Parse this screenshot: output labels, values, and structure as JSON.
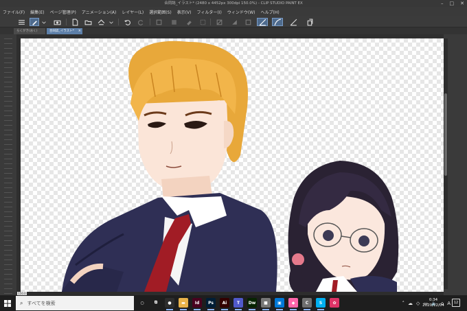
{
  "window": {
    "title": "合同誌_イラスト* (2480 x 4452px 300dpi 150.0%) - CLIP STUDIO PAINT EX",
    "min_icon": "minimize-icon",
    "max_icon": "maximize-icon",
    "close_icon": "close-icon"
  },
  "menu": {
    "items": [
      "ファイル(F)",
      "編集(E)",
      "ページ管理(P)",
      "アニメーション(A)",
      "レイヤー(L)",
      "選択範囲(S)",
      "表示(V)",
      "フィルター(I)",
      "ウィンドウ(W)",
      "ヘルプ(H)"
    ]
  },
  "toolbar": {
    "icons": [
      "menu-icon",
      "pen-tool-icon",
      "dropdown-icon",
      "camera-icon",
      "new-file-icon",
      "open-folder-icon",
      "save-icon",
      "scan-icon",
      "undo-icon",
      "redo-icon",
      "transform-icon",
      "fill-icon",
      "erase-icon",
      "select-rect-icon",
      "hide-selection-icon",
      "stroke-active-icon",
      "curve-active-icon",
      "ruler-icon",
      "export-icon"
    ],
    "accent": "#4e6b8e"
  },
  "tabs": [
    {
      "label": "らくがき(おく)",
      "active": false
    },
    {
      "label": "合同誌_イラスト*",
      "active": true,
      "close": "×"
    }
  ],
  "canvas": {
    "zoom": "150.0",
    "checker_color": "#e6e6e6"
  },
  "taskbar": {
    "search_placeholder": "すべてを検索",
    "apps": [
      {
        "name": "cortana-icon",
        "label": "○",
        "color": "#1e1e1e"
      },
      {
        "name": "task-view-icon",
        "label": "⧉",
        "color": "#1e1e1e"
      },
      {
        "name": "chrome-icon",
        "label": "●",
        "color": "#2d2d2d"
      },
      {
        "name": "explorer-icon",
        "label": "▬",
        "color": "#e8b24a"
      },
      {
        "name": "indesign-icon",
        "label": "Id",
        "color": "#49021f"
      },
      {
        "name": "photoshop-icon",
        "label": "Ps",
        "color": "#001e36"
      },
      {
        "name": "illustrator-icon",
        "label": "Ai",
        "color": "#330000"
      },
      {
        "name": "teams-icon",
        "label": "T",
        "color": "#5059c9"
      },
      {
        "name": "dreamweaver-icon",
        "label": "Dw",
        "color": "#072401"
      },
      {
        "name": "app-icon",
        "label": "■",
        "color": "#777"
      },
      {
        "name": "store-icon",
        "label": "▣",
        "color": "#0078d7"
      },
      {
        "name": "paint-icon",
        "label": "◆",
        "color": "#f6a"
      },
      {
        "name": "clipstudio-icon",
        "label": "C",
        "color": "#6f6f6f"
      },
      {
        "name": "skype-icon",
        "label": "S",
        "color": "#00aff0"
      },
      {
        "name": "photos-icon",
        "label": "✿",
        "color": "#d36"
      }
    ],
    "tray_icons": [
      "chevron-up-icon",
      "cloud-icon",
      "dropbox-icon",
      "wifi-icon",
      "volume-icon",
      "network-icon",
      "ime-icon"
    ],
    "ime_label": "A",
    "time": "0:34",
    "date": "2020/12/04",
    "notifications": "12"
  }
}
